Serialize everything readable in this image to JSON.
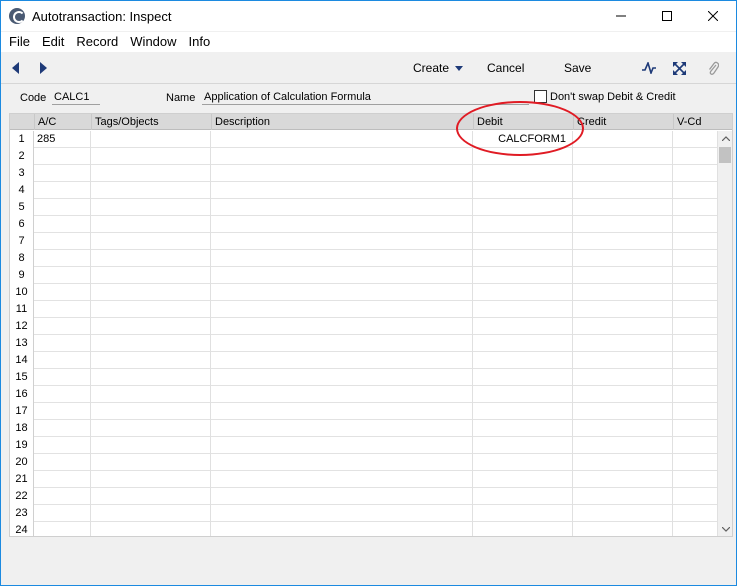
{
  "window": {
    "title": "Autotransaction: Inspect",
    "controls": {
      "minimize": "–",
      "maximize": "☐",
      "close": "✕"
    }
  },
  "menu": [
    "File",
    "Edit",
    "Record",
    "Window",
    "Info"
  ],
  "toolbar": {
    "create_label": "Create",
    "cancel_label": "Cancel",
    "save_label": "Save"
  },
  "form": {
    "code_label": "Code",
    "code_value": "CALC1",
    "name_label": "Name",
    "name_value": "Application of Calculation Formula",
    "swap_label": "Don't swap Debit & Credit",
    "swap_checked": false
  },
  "grid": {
    "columns": [
      "A/C",
      "Tags/Objects",
      "Description",
      "Debit",
      "Credit",
      "V-Cd"
    ],
    "rows": [
      {
        "num": "1",
        "ac": "285",
        "tags": "",
        "desc": "",
        "debit": "CALCFORM1",
        "credit": "",
        "vcd": ""
      },
      {
        "num": "2"
      },
      {
        "num": "3"
      },
      {
        "num": "4"
      },
      {
        "num": "5"
      },
      {
        "num": "6"
      },
      {
        "num": "7"
      },
      {
        "num": "8"
      },
      {
        "num": "9"
      },
      {
        "num": "10"
      },
      {
        "num": "11"
      },
      {
        "num": "12"
      },
      {
        "num": "13"
      },
      {
        "num": "14"
      },
      {
        "num": "15"
      },
      {
        "num": "16"
      },
      {
        "num": "17"
      },
      {
        "num": "18"
      },
      {
        "num": "19"
      },
      {
        "num": "20"
      },
      {
        "num": "21"
      },
      {
        "num": "22"
      },
      {
        "num": "23"
      },
      {
        "num": "24"
      }
    ]
  },
  "annotation": {
    "color": "#e01b24"
  },
  "colors": {
    "window_border": "#1c8ae0",
    "accent": "#1e3a78"
  }
}
